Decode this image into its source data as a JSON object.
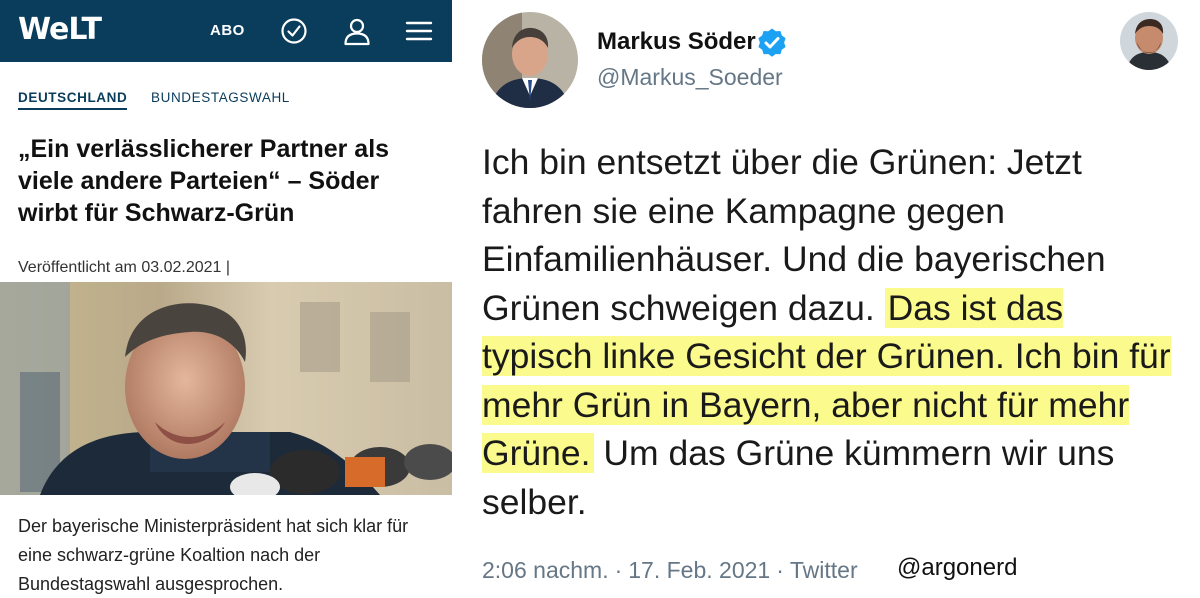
{
  "welt": {
    "logo": "WeLT",
    "abo": "ABO",
    "icons": [
      "clock-check-icon",
      "user-icon",
      "menu-icon"
    ],
    "kicker_primary": "DEUTSCHLAND",
    "kicker_secondary": "BUNDESTAGSWAHL",
    "headline": "„Ein verlässlicherer Partner als viele andere Parteien“ – Söder wirbt für Schwarz-Grün",
    "published": "Veröffentlicht am 03.02.2021 |",
    "teaser": "Der bayerische Ministerpräsident hat sich klar für eine schwarz-grüne Koaltion nach der Bundestagswahl ausgesprochen.",
    "brand_color": "#0a3c5c"
  },
  "tweet": {
    "display_name": "Markus Söder",
    "handle": "@Markus_Soeder",
    "verified": true,
    "text_part1": "Ich bin entsetzt über die Grünen: Jetzt fahren sie eine Kampagne gegen Einfamilienhäuser. Und die bayerischen Grünen schweigen dazu.",
    "text_highlight": "Das ist das typisch linke Gesicht der Grünen. Ich bin für mehr Grün in Bayern, aber nicht für mehr Grüne.",
    "text_part2": "Um das Grüne kümmern wir uns selber.",
    "time": "2:06 nachm.",
    "date": "17. Feb. 2021",
    "source": "Twitter",
    "credit": "@argonerd",
    "highlight_color": "#fbfa8c",
    "verified_color": "#1da1f2"
  }
}
